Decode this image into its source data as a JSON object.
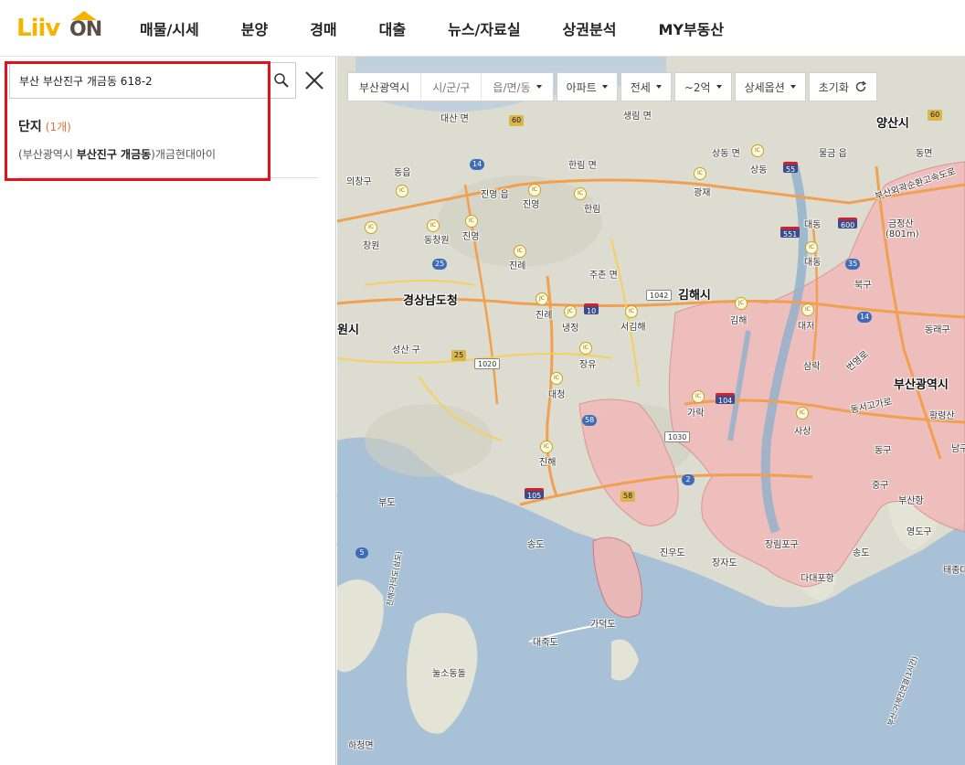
{
  "header": {
    "logo_text": "LiivON",
    "logo_part1": "Liiv",
    "logo_part2": "ON",
    "nav": [
      "매물/시세",
      "분양",
      "경매",
      "대출",
      "뉴스/자료실",
      "상권분석",
      "MY부동산"
    ]
  },
  "search": {
    "value": "부산 부산진구 개금동 618-2"
  },
  "results": {
    "category": "단지",
    "count": "(1개)",
    "item_prefix": "(부산광역시 ",
    "item_bold": "부산진구 개금동",
    "item_suffix": ")개금현대아이"
  },
  "filters": {
    "region1": "부산광역시",
    "region2": "시/군/구",
    "region3": "읍/면/동",
    "type": "아파트",
    "deal": "전세",
    "price": "~2억",
    "detail": "상세옵션",
    "reset": "초기화"
  },
  "map_labels": [
    {
      "t": "대산 면",
      "s": "s"
    },
    {
      "t": "생림 면",
      "s": "s"
    },
    {
      "t": "양산시",
      "s": "l"
    },
    {
      "t": "의창구",
      "s": "s"
    },
    {
      "t": "동읍",
      "s": "s"
    },
    {
      "t": "한림 면",
      "s": "s"
    },
    {
      "t": "상동 면",
      "s": "s"
    },
    {
      "t": "물금 읍",
      "s": "s"
    },
    {
      "t": "동면",
      "s": "s"
    },
    {
      "t": "진영 읍",
      "s": "s"
    },
    {
      "t": "진영",
      "s": "s"
    },
    {
      "t": "한림",
      "s": "s"
    },
    {
      "t": "광재",
      "s": "s"
    },
    {
      "t": "상동",
      "s": "s"
    },
    {
      "t": "대동",
      "s": "s"
    },
    {
      "t": "금정산",
      "s": "s"
    },
    {
      "t": "(801m)",
      "s": "s"
    },
    {
      "t": "창원",
      "s": "s"
    },
    {
      "t": "동창원",
      "s": "s"
    },
    {
      "t": "진영",
      "s": "s"
    },
    {
      "t": "진례",
      "s": "s"
    },
    {
      "t": "주촌 면",
      "s": "s"
    },
    {
      "t": "대동",
      "s": "s"
    },
    {
      "t": "북구",
      "s": "s"
    },
    {
      "t": "경상남도청",
      "s": "l"
    },
    {
      "t": "김해시",
      "s": "l"
    },
    {
      "t": "진례",
      "s": "s"
    },
    {
      "t": "냉정",
      "s": "s"
    },
    {
      "t": "서김해",
      "s": "s"
    },
    {
      "t": "김해",
      "s": "s"
    },
    {
      "t": "대저",
      "s": "s"
    },
    {
      "t": "동래구",
      "s": "s"
    },
    {
      "t": "원시",
      "s": "l"
    },
    {
      "t": "성산 구",
      "s": "s"
    },
    {
      "t": "장유",
      "s": "s"
    },
    {
      "t": "삼락",
      "s": "s"
    },
    {
      "t": "부산광역시",
      "s": "l"
    },
    {
      "t": "대청",
      "s": "s"
    },
    {
      "t": "가락",
      "s": "s"
    },
    {
      "t": "사상",
      "s": "s"
    },
    {
      "t": "황령산",
      "s": "s"
    },
    {
      "t": "동구",
      "s": "s"
    },
    {
      "t": "진해",
      "s": "s"
    },
    {
      "t": "중구",
      "s": "s"
    },
    {
      "t": "부도",
      "s": "s"
    },
    {
      "t": "부산항",
      "s": "s"
    },
    {
      "t": "영도구",
      "s": "s"
    },
    {
      "t": "송도",
      "s": "s"
    },
    {
      "t": "진우도",
      "s": "s"
    },
    {
      "t": "장자도",
      "s": "s"
    },
    {
      "t": "장림포구",
      "s": "s"
    },
    {
      "t": "송도",
      "s": "s"
    },
    {
      "t": "다대포항",
      "s": "s"
    },
    {
      "t": "태종대",
      "s": "s"
    },
    {
      "t": "가덕도",
      "s": "s"
    },
    {
      "t": "대죽도",
      "s": "s"
    },
    {
      "t": "눌소동돌",
      "s": "s"
    },
    {
      "t": "하청면",
      "s": "s"
    },
    {
      "t": "남구",
      "s": "s"
    },
    {
      "t": "부산외곽순환고속도로",
      "s": "s"
    },
    {
      "t": "번영로",
      "s": "s"
    },
    {
      "t": "동서고가로",
      "s": "s"
    },
    {
      "t": "부산-거제간연결(1시간)",
      "s": "s"
    },
    {
      "t": "진해-가덕도(삼도)",
      "s": "s"
    }
  ],
  "map_shields": [
    {
      "t": "60",
      "k": "yellow"
    },
    {
      "t": "14",
      "k": "blue"
    },
    {
      "t": "55",
      "k": "red"
    },
    {
      "t": "60",
      "k": "yellow"
    },
    {
      "t": "551",
      "k": "red"
    },
    {
      "t": "600",
      "k": "red"
    },
    {
      "t": "25",
      "k": "blue"
    },
    {
      "t": "35",
      "k": "blue"
    },
    {
      "t": "1042",
      "k": "white"
    },
    {
      "t": "10",
      "k": "red"
    },
    {
      "t": "14",
      "k": "blue"
    },
    {
      "t": "25",
      "k": "yellow"
    },
    {
      "t": "1020",
      "k": "white"
    },
    {
      "t": "104",
      "k": "red"
    },
    {
      "t": "58",
      "k": "blue"
    },
    {
      "t": "1030",
      "k": "white"
    },
    {
      "t": "2",
      "k": "blue"
    },
    {
      "t": "105",
      "k": "red"
    },
    {
      "t": "58",
      "k": "yellow"
    },
    {
      "t": "5",
      "k": "blue"
    }
  ]
}
